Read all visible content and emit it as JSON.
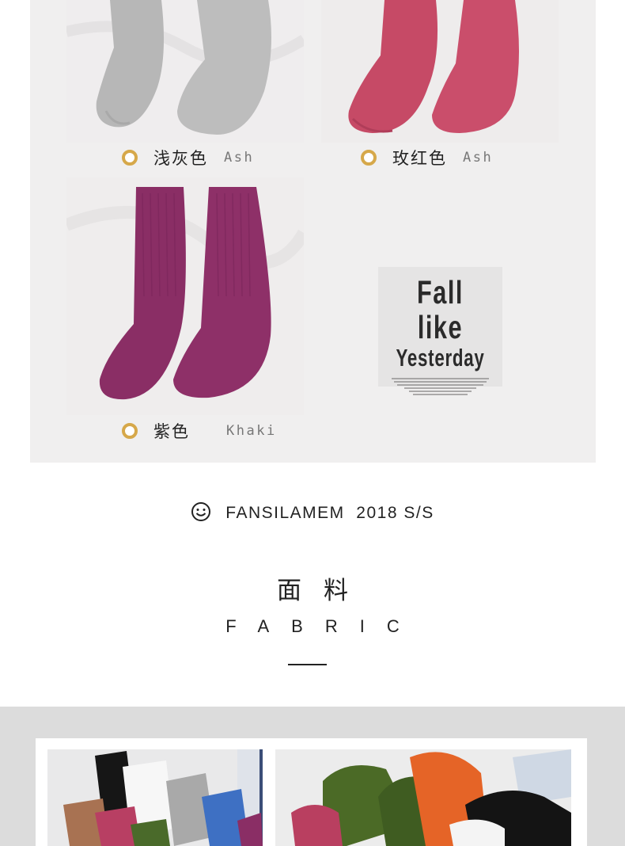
{
  "products": [
    {
      "cn": "浅灰色",
      "en": "Ash",
      "color": "#b9b9b9",
      "photo_icon": "grey-socks-photo"
    },
    {
      "cn": "玫红色",
      "en": "Ash",
      "color": "#c94a68",
      "photo_icon": "rose-red-socks-photo"
    },
    {
      "cn": "紫色",
      "en": "Khaki",
      "color": "#8b2f66",
      "photo_icon": "purple-socks-photo"
    }
  ],
  "fall_card": {
    "title": "Fall like",
    "subtitle": "Yesterday"
  },
  "brand": {
    "icon": "smiley-icon",
    "text": "FANSILAMEM  2018 S/S"
  },
  "section": {
    "title_cn": "面料",
    "title_en": "FABRIC"
  },
  "colors": {
    "accent_dot": "#d6a84a",
    "panel_bg": "#f0efef",
    "band_bg": "#dcdcdc"
  }
}
